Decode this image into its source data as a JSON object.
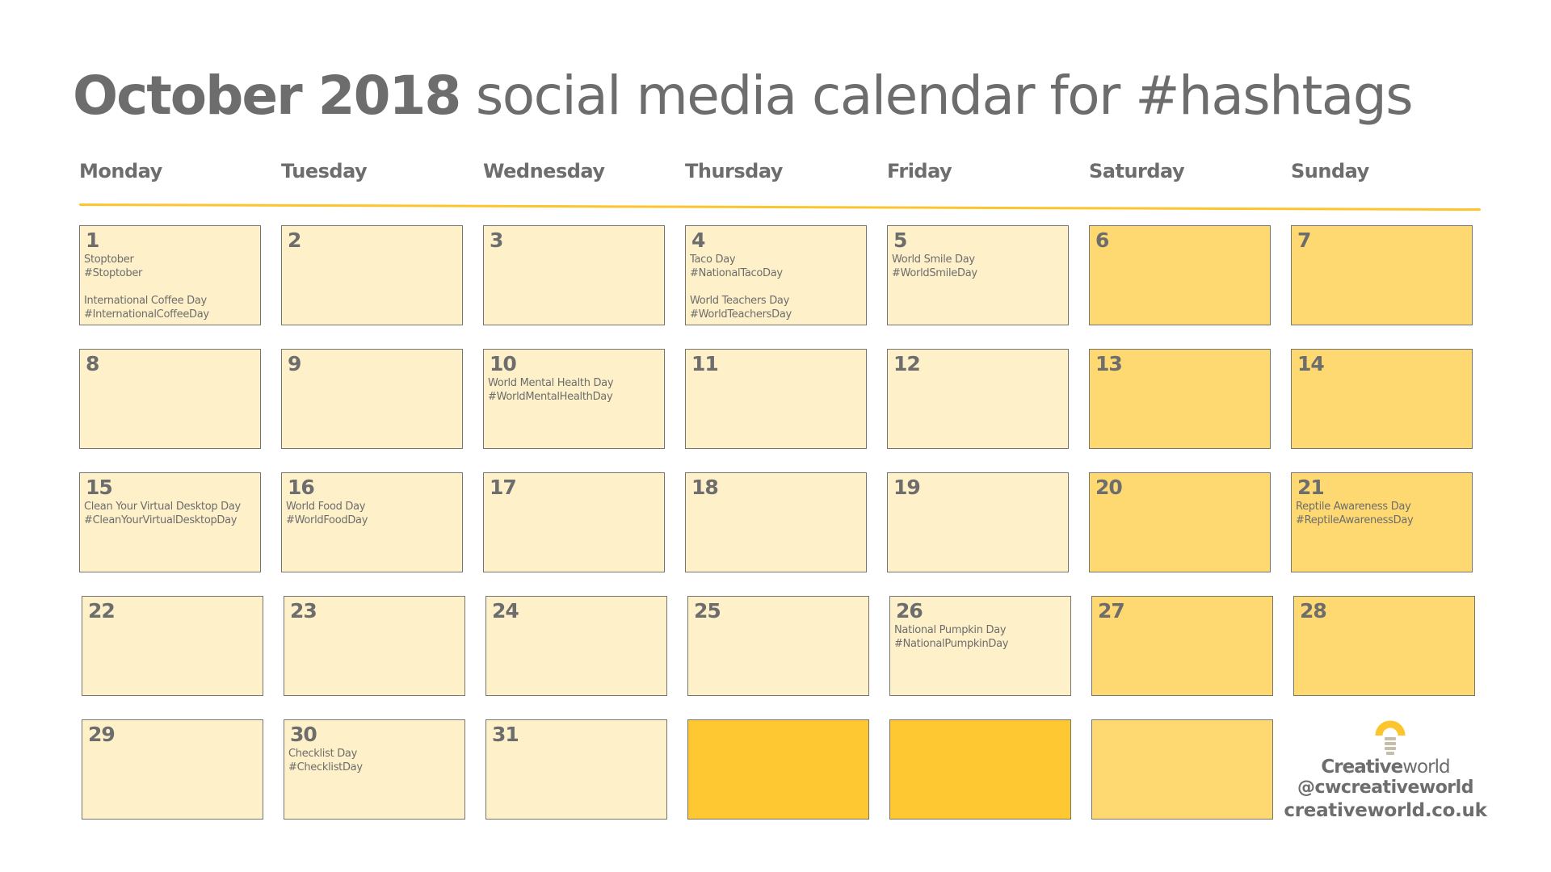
{
  "title": {
    "bold": "October 2018",
    "rest": " social media calendar for #hashtags"
  },
  "colors": {
    "text": "#6d6d6d",
    "accent": "#fcc52e",
    "weekday_cell": "#fef0c8",
    "weekend_cell": "#fed870",
    "filler_cell": "#fec833",
    "cell_border": "#777570"
  },
  "day_headers": [
    "Monday",
    "Tuesday",
    "Wednesday",
    "Thursday",
    "Friday",
    "Saturday",
    "Sunday"
  ],
  "weeks": [
    [
      {
        "date": "1",
        "type": "weekday",
        "events": [
          {
            "name": "Stoptober",
            "hashtag": "#Stoptober"
          },
          {
            "name": "International Coffee Day",
            "hashtag": "#InternationalCoffeeDay"
          }
        ]
      },
      {
        "date": "2",
        "type": "weekday",
        "events": []
      },
      {
        "date": "3",
        "type": "weekday",
        "events": []
      },
      {
        "date": "4",
        "type": "weekday",
        "events": [
          {
            "name": "Taco Day",
            "hashtag": "#NationalTacoDay"
          },
          {
            "name": "World Teachers Day",
            "hashtag": "#WorldTeachersDay"
          }
        ]
      },
      {
        "date": "5",
        "type": "weekday",
        "events": [
          {
            "name": "World Smile Day",
            "hashtag": "#WorldSmileDay"
          }
        ]
      },
      {
        "date": "6",
        "type": "weekend",
        "events": []
      },
      {
        "date": "7",
        "type": "weekend",
        "events": []
      }
    ],
    [
      {
        "date": "8",
        "type": "weekday",
        "events": []
      },
      {
        "date": "9",
        "type": "weekday",
        "events": []
      },
      {
        "date": "10",
        "type": "weekday",
        "events": [
          {
            "name": "World Mental Health Day",
            "hashtag": "#WorldMentalHealthDay"
          }
        ]
      },
      {
        "date": "11",
        "type": "weekday",
        "events": []
      },
      {
        "date": "12",
        "type": "weekday",
        "events": []
      },
      {
        "date": "13",
        "type": "weekend",
        "events": []
      },
      {
        "date": "14",
        "type": "weekend",
        "events": []
      }
    ],
    [
      {
        "date": "15",
        "type": "weekday",
        "events": [
          {
            "name": "Clean Your Virtual Desktop Day",
            "hashtag": "#CleanYourVirtualDesktopDay"
          }
        ]
      },
      {
        "date": "16",
        "type": "weekday",
        "events": [
          {
            "name": "World Food Day",
            "hashtag": "#WorldFoodDay"
          }
        ]
      },
      {
        "date": "17",
        "type": "weekday",
        "events": []
      },
      {
        "date": "18",
        "type": "weekday",
        "events": []
      },
      {
        "date": "19",
        "type": "weekday",
        "events": []
      },
      {
        "date": "20",
        "type": "weekend",
        "events": []
      },
      {
        "date": "21",
        "type": "weekend",
        "events": [
          {
            "name": "Reptile Awareness Day",
            "hashtag": "#ReptileAwarenessDay"
          }
        ]
      }
    ],
    [
      {
        "date": "22",
        "type": "weekday",
        "events": []
      },
      {
        "date": "23",
        "type": "weekday",
        "events": []
      },
      {
        "date": "24",
        "type": "weekday",
        "events": []
      },
      {
        "date": "25",
        "type": "weekday",
        "events": []
      },
      {
        "date": "26",
        "type": "weekday",
        "events": [
          {
            "name": "National Pumpkin Day",
            "hashtag": "#NationalPumpkinDay"
          }
        ]
      },
      {
        "date": "27",
        "type": "weekend",
        "events": []
      },
      {
        "date": "28",
        "type": "weekend",
        "events": []
      }
    ],
    [
      {
        "date": "29",
        "type": "weekday",
        "events": []
      },
      {
        "date": "30",
        "type": "weekday",
        "events": [
          {
            "name": "Checklist Day",
            "hashtag": "#ChecklistDay"
          }
        ]
      },
      {
        "date": "31",
        "type": "weekday",
        "events": []
      },
      {
        "date": "",
        "type": "filler",
        "events": []
      },
      {
        "date": "",
        "type": "filler",
        "events": []
      },
      {
        "date": "",
        "type": "weekend",
        "events": []
      }
    ]
  ],
  "logo": {
    "icon": "lightbulb-icon",
    "brand_bold": "Creative",
    "brand_light": "world",
    "handle": "@cwcreativeworld",
    "website": "creativeworld.co.uk"
  }
}
